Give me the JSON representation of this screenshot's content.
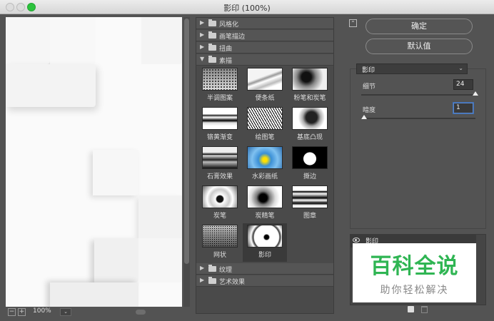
{
  "window": {
    "title": "影印 (100%)"
  },
  "preview": {
    "zoom_minus": "−",
    "zoom_plus": "+",
    "zoom": "100%",
    "zoom_chevron": "⌄"
  },
  "gallery": {
    "categories_top": [
      {
        "label": "风格化",
        "expanded": false
      },
      {
        "label": "画笔描边",
        "expanded": false
      },
      {
        "label": "扭曲",
        "expanded": false
      },
      {
        "label": "素描",
        "expanded": true
      }
    ],
    "sketch_filters": [
      {
        "label": "半调图案",
        "selected": false
      },
      {
        "label": "便条纸",
        "selected": false
      },
      {
        "label": "粉笔和炭笔",
        "selected": false
      },
      {
        "label": "铬黄渐变",
        "selected": false
      },
      {
        "label": "绘图笔",
        "selected": false
      },
      {
        "label": "基底凸现",
        "selected": false
      },
      {
        "label": "石膏效果",
        "selected": false
      },
      {
        "label": "水彩画纸",
        "selected": false
      },
      {
        "label": "撕边",
        "selected": false
      },
      {
        "label": "炭笔",
        "selected": false
      },
      {
        "label": "炭精笔",
        "selected": false
      },
      {
        "label": "图章",
        "selected": false
      },
      {
        "label": "网状",
        "selected": false
      },
      {
        "label": "影印",
        "selected": true
      }
    ],
    "categories_bottom": [
      {
        "label": "纹理",
        "expanded": false
      },
      {
        "label": "艺术效果",
        "expanded": false
      }
    ]
  },
  "panel": {
    "collapse_glyph": "⌃",
    "ok_label": "确定",
    "default_label": "默认值",
    "filter_select": "影印",
    "filter_chevron": "⌄",
    "params": [
      {
        "label": "细节",
        "value": "24",
        "level": 1.0
      },
      {
        "label": "暗度",
        "value": "1",
        "level": 0.0
      }
    ]
  },
  "layers": {
    "items": [
      {
        "name": "影印",
        "visible": true
      }
    ]
  },
  "watermark": {
    "title": "百科全说",
    "subtitle": "助你轻松解决"
  }
}
